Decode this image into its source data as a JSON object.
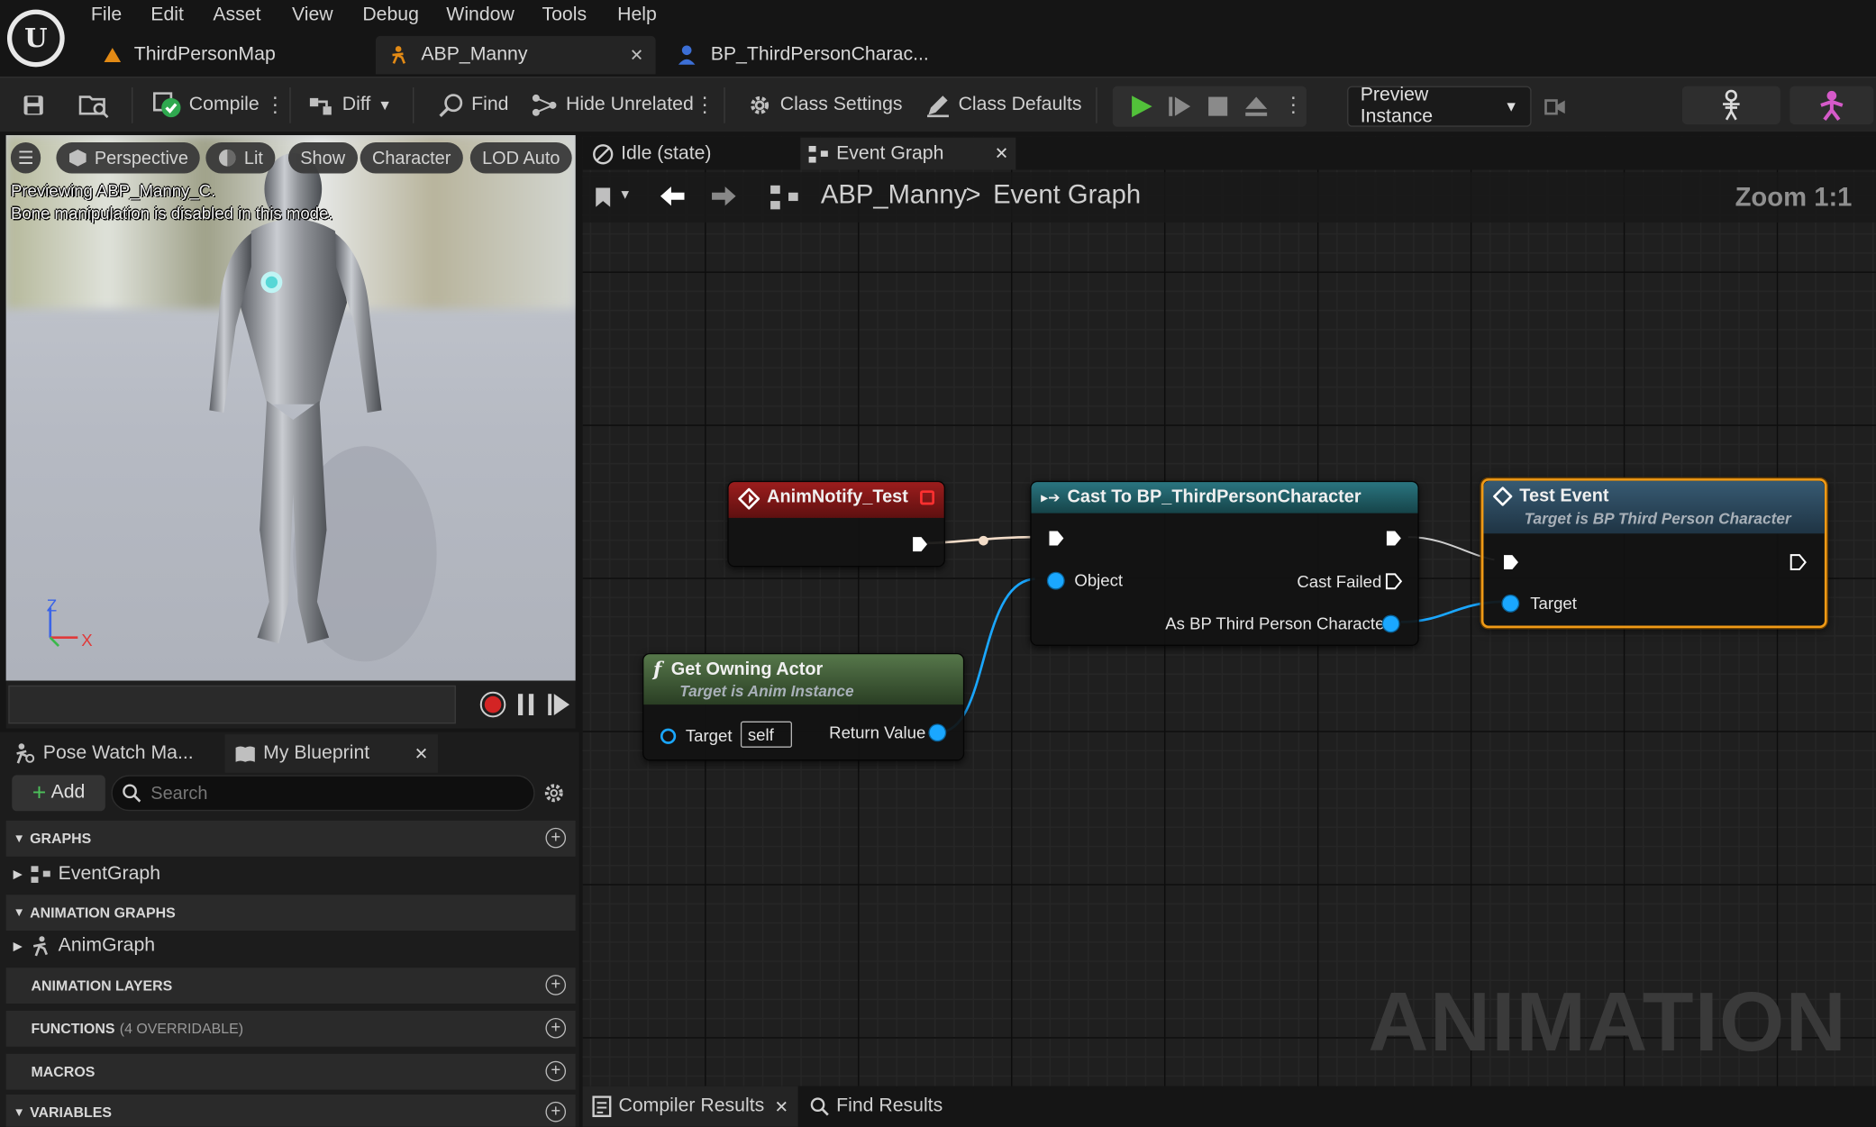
{
  "menu": [
    "File",
    "Edit",
    "Asset",
    "View",
    "Debug",
    "Window",
    "Tools",
    "Help"
  ],
  "doc_tabs": [
    {
      "label": "ThirdPersonMap"
    },
    {
      "label": "ABP_Manny"
    },
    {
      "label": "BP_ThirdPersonCharac..."
    }
  ],
  "toolbar": {
    "compile": "Compile",
    "diff": "Diff",
    "find": "Find",
    "hide_unrelated": "Hide Unrelated",
    "class_settings": "Class Settings",
    "class_defaults": "Class Defaults",
    "preview_instance": "Preview Instance"
  },
  "viewport": {
    "chips": {
      "perspective": "Perspective",
      "lit": "Lit",
      "show": "Show",
      "character": "Character",
      "lod": "LOD Auto"
    },
    "info_line1": "Previewing ABP_Manny_C.",
    "info_line2": "Bone manipulation is disabled in this mode.",
    "axis_z": "Z",
    "axis_x": "X"
  },
  "left_tabs": {
    "pose_watch": "Pose Watch Ma...",
    "my_blueprint": "My Blueprint"
  },
  "my_blueprint": {
    "add": "Add",
    "search_placeholder": "Search",
    "graphs_header": "GRAPHS",
    "event_graph": "EventGraph",
    "anim_graphs_header": "ANIMATION GRAPHS",
    "anim_graph": "AnimGraph",
    "anim_layers_header": "ANIMATION LAYERS",
    "functions_header": "FUNCTIONS",
    "functions_note": "(4 OVERRIDABLE)",
    "macros_header": "MACROS",
    "variables_header": "VARIABLES"
  },
  "graph": {
    "tabs": {
      "idle": "Idle (state)",
      "event_graph": "Event Graph"
    },
    "breadcrumb": {
      "root": "ABP_Manny",
      "sep": ">",
      "current": "Event Graph"
    },
    "zoom": "Zoom 1:1",
    "watermark": "ANIMATION",
    "nodes": {
      "anim_notify": {
        "title": "AnimNotify_Test"
      },
      "cast": {
        "title": "Cast To BP_ThirdPersonCharacter",
        "object": "Object",
        "cast_failed": "Cast Failed",
        "as_bp": "As BP Third Person Character"
      },
      "test_event": {
        "title": "Test Event",
        "subtitle": "Target is BP Third Person Character",
        "target": "Target"
      },
      "get_owning": {
        "title": "Get Owning Actor",
        "subtitle": "Target is Anim Instance",
        "target": "Target",
        "self": "self",
        "return_value": "Return Value"
      }
    }
  },
  "bottom_tabs": {
    "compiler": "Compiler Results",
    "find": "Find Results"
  },
  "colors": {
    "accent_orange": "#f09a16",
    "pin_blue": "#1aa7ff",
    "exec_white": "#ffffff",
    "event_red": "#8a1a1a",
    "cast_teal": "#1c5f67",
    "func_green": "#4a6b3f"
  }
}
